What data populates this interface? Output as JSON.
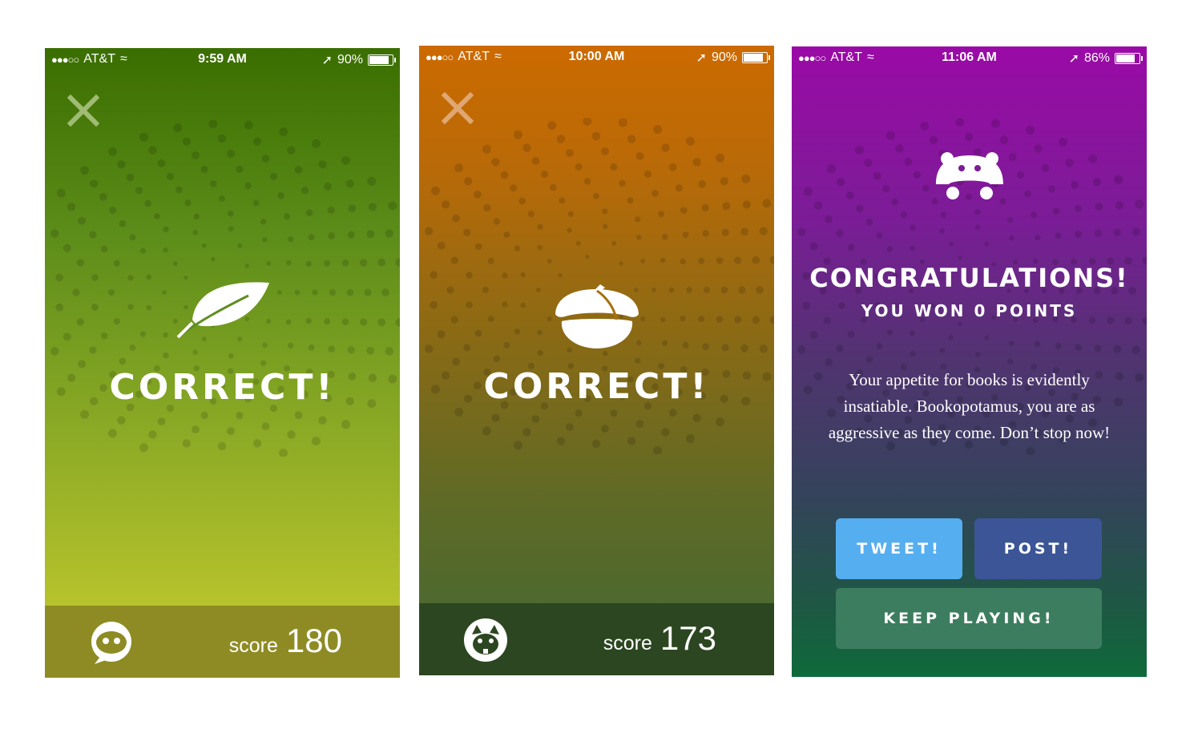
{
  "screens": [
    {
      "status": {
        "carrier": "AT&T",
        "time": "9:59 AM",
        "battery": "90%",
        "battery_level": 0.9
      },
      "result": "CORRECT!",
      "icon": "leaf-icon",
      "footer": {
        "score_label": "score",
        "score_value": "180",
        "avatar": "chat-bubble-face-icon"
      }
    },
    {
      "status": {
        "carrier": "AT&T",
        "time": "10:00 AM",
        "battery": "90%",
        "battery_level": 0.9
      },
      "result": "CORRECT!",
      "icon": "acorn-icon",
      "footer": {
        "score_label": "score",
        "score_value": "173",
        "avatar": "squirrel-face-icon"
      }
    },
    {
      "status": {
        "carrier": "AT&T",
        "time": "11:06 AM",
        "battery": "86%",
        "battery_level": 0.86
      },
      "icon": "hippo-icon",
      "title": "CONGRATULATIONS!",
      "subtitle": "YOU WON 0 POINTS",
      "message": "Your appetite for books is evidently insatiable. Bookopotamus, you are as aggressive as they come. Don’t stop now!",
      "buttons": {
        "tweet": "TWEET!",
        "post": "POST!",
        "keep_playing": "KEEP PLAYING!"
      },
      "colors": {
        "tweet": "#55aef0",
        "post": "#3b5597",
        "keep_playing": "#3d7d5f"
      }
    }
  ]
}
